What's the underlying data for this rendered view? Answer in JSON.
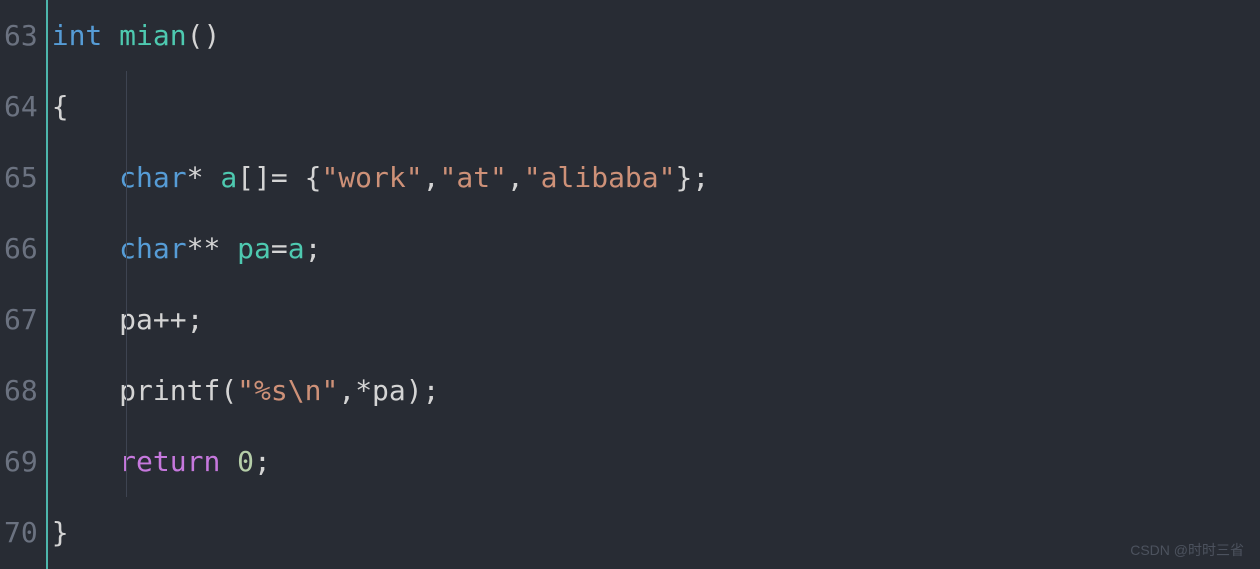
{
  "editor": {
    "lines": [
      {
        "number": "63"
      },
      {
        "number": "64"
      },
      {
        "number": "65"
      },
      {
        "number": "66"
      },
      {
        "number": "67"
      },
      {
        "number": "68"
      },
      {
        "number": "69"
      },
      {
        "number": "70"
      }
    ],
    "code": {
      "l63_kw_int": "int",
      "l63_sp1": " ",
      "l63_fn": "mian",
      "l63_paren": "()",
      "l64_brace": "{",
      "l65_indent": "    ",
      "l65_kw_char": "char",
      "l65_star": "*",
      "l65_sp1": " ",
      "l65_var_a": "a",
      "l65_brackets": "[]",
      "l65_eq": "= ",
      "l65_lbrace": "{",
      "l65_str1": "\"work\"",
      "l65_comma1": ",",
      "l65_str2": "\"at\"",
      "l65_comma2": ",",
      "l65_str3": "\"alibaba\"",
      "l65_rbrace": "}",
      "l65_semi": ";",
      "l66_indent": "    ",
      "l66_kw_char": "char",
      "l66_star": "**",
      "l66_sp1": " ",
      "l66_var_pa": "pa",
      "l66_eq": "=",
      "l66_var_a": "a",
      "l66_semi": ";",
      "l67_indent": "    ",
      "l67_var_pa": "pa",
      "l67_inc": "++",
      "l67_semi": ";",
      "l68_indent": "    ",
      "l68_fn": "printf",
      "l68_lparen": "(",
      "l68_str": "\"%s\\n\"",
      "l68_comma": ",",
      "l68_star": "*",
      "l68_var_pa": "pa",
      "l68_rparen": ")",
      "l68_semi": ";",
      "l69_indent": "    ",
      "l69_kw_return": "return",
      "l69_sp": " ",
      "l69_num": "0",
      "l69_semi": ";",
      "l70_brace": "}"
    }
  },
  "watermark": "CSDN @时时三省"
}
